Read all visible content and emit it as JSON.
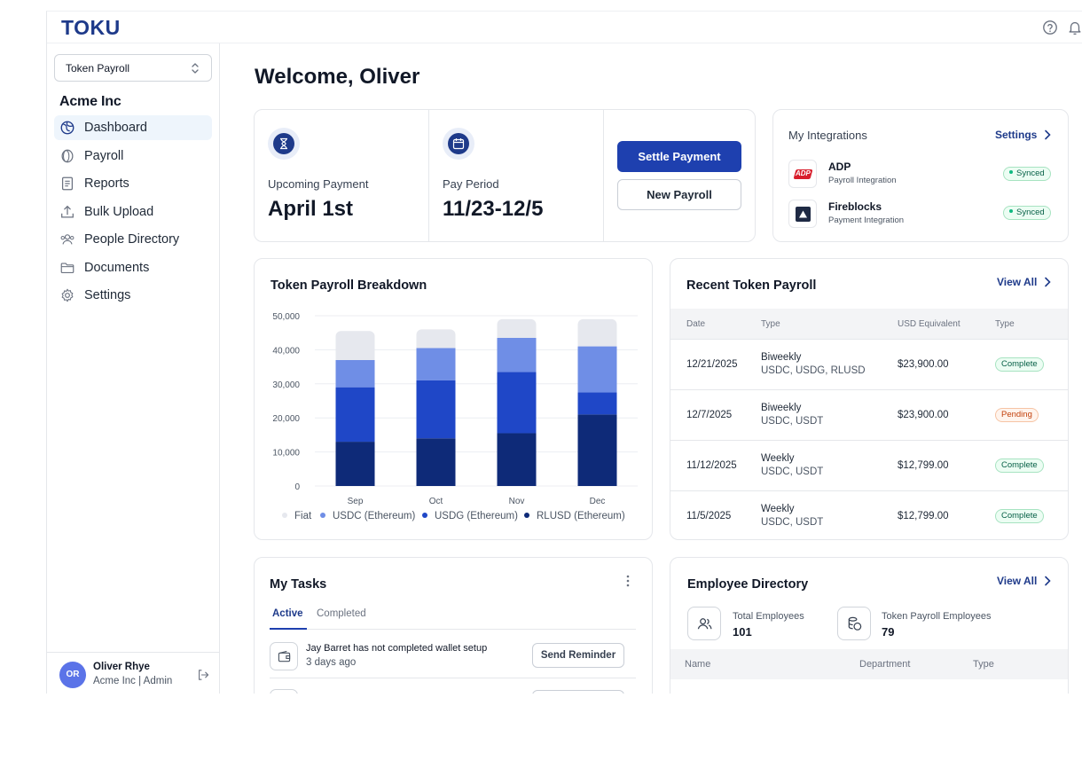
{
  "app": {
    "logo": "TOKU"
  },
  "sidebar": {
    "workspace": "Token Payroll",
    "org": "Acme Inc",
    "items": [
      {
        "label": "Dashboard",
        "icon": "dashboard-icon",
        "active": true
      },
      {
        "label": "Payroll",
        "icon": "coin-icon"
      },
      {
        "label": "Reports",
        "icon": "report-icon"
      },
      {
        "label": "Bulk Upload",
        "icon": "upload-icon"
      },
      {
        "label": "People Directory",
        "icon": "people-icon"
      },
      {
        "label": "Documents",
        "icon": "folder-icon"
      },
      {
        "label": "Settings",
        "icon": "gear-icon"
      }
    ],
    "user": {
      "initials": "OR",
      "name": "Oliver Rhye",
      "role": "Acme Inc | Admin"
    }
  },
  "main": {
    "welcome": "Welcome, Oliver",
    "summary": {
      "upcoming_label": "Upcoming Payment",
      "upcoming_value": "April 1st",
      "period_label": "Pay Period",
      "period_value": "11/23-12/5",
      "settle_button": "Settle Payment",
      "new_button": "New Payroll"
    },
    "integrations": {
      "title": "My Integrations",
      "settings_link": "Settings",
      "items": [
        {
          "name": "ADP",
          "sub": "Payroll Integration",
          "status": "Synced",
          "logo_text": "ADP"
        },
        {
          "name": "Fireblocks",
          "sub": "Payment Integration",
          "status": "Synced"
        }
      ]
    },
    "breakdown": {
      "title": "Token Payroll Breakdown"
    },
    "recent": {
      "title": "Recent Token Payroll",
      "view_all": "View All",
      "columns": [
        "Date",
        "Type",
        "USD Equivalent",
        "Type"
      ],
      "rows": [
        {
          "date": "12/21/2025",
          "type": "Biweekly",
          "tokens": "USDC, USDG, RLUSD",
          "usd": "$23,900.00",
          "status": "Complete",
          "status_kind": "green"
        },
        {
          "date": "12/7/2025",
          "type": "Biweekly",
          "tokens": "USDC, USDT",
          "usd": "$23,900.00",
          "status": "Pending",
          "status_kind": "orange"
        },
        {
          "date": "11/12/2025",
          "type": "Weekly",
          "tokens": "USDC, USDT",
          "usd": "$12,799.00",
          "status": "Complete",
          "status_kind": "green"
        },
        {
          "date": "11/5/2025",
          "type": "Weekly",
          "tokens": "USDC, USDT",
          "usd": "$12,799.00",
          "status": "Complete",
          "status_kind": "green"
        }
      ]
    },
    "tasks": {
      "title": "My Tasks",
      "tabs": [
        "Active",
        "Completed"
      ],
      "items": [
        {
          "title": "Jay Barret has not completed wallet setup",
          "sub": "3 days ago",
          "action": "Send Reminder"
        }
      ]
    },
    "employees": {
      "title": "Employee Directory",
      "view_all": "View All",
      "total_label": "Total Employees",
      "total_value": "101",
      "token_label": "Token Payroll Employees",
      "token_value": "79",
      "columns": [
        "Name",
        "Department",
        "Type"
      ]
    }
  },
  "chart_data": {
    "type": "bar",
    "stacked": true,
    "title": "",
    "categories": [
      "Sep",
      "Oct",
      "Nov",
      "Dec"
    ],
    "ylim": [
      0,
      50000
    ],
    "yticks": [
      "0",
      "10,000",
      "20,000",
      "30,000",
      "40,000",
      "50,000"
    ],
    "ytick_values": [
      0,
      10000,
      20000,
      30000,
      40000,
      50000
    ],
    "grid": true,
    "legend_position": "bottom",
    "series": [
      {
        "name": "RLUSD (Ethereum)",
        "color": "#0e2a78",
        "values": [
          13000,
          14000,
          15500,
          21000
        ]
      },
      {
        "name": "USDG (Ethereum)",
        "color": "#1f47c7",
        "values": [
          16000,
          17000,
          18000,
          6500
        ]
      },
      {
        "name": "USDC (Ethereum)",
        "color": "#6f8ee6",
        "values": [
          8000,
          9500,
          10000,
          13500
        ]
      },
      {
        "name": "Fiat",
        "color": "#e6e8ee",
        "values": [
          8500,
          5500,
          5500,
          8000
        ]
      }
    ],
    "legend_order": [
      "Fiat",
      "USDC (Ethereum)",
      "USDG (Ethereum)",
      "RLUSD (Ethereum)"
    ]
  }
}
